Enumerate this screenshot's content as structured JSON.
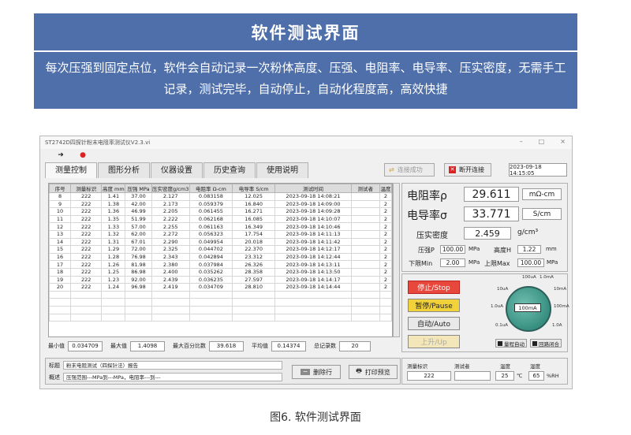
{
  "banner": {
    "title": "软件测试界面",
    "text": "每次压强到固定点位，软件会自动记录一次粉体高度、压强、电阻率、电导率、压实密度，无需手工记录，测试完毕，自动停止，自动化程度高，高效快捷"
  },
  "window": {
    "title": "ST2742D四探针粉末电阻率测试仪V2.3.vi",
    "tabs": [
      "测量控制",
      "图形分析",
      "仪器设置",
      "历史查询",
      "使用说明"
    ],
    "connect_success": "连接成功",
    "disconnect": "断开连接",
    "datetime": "2023-09-18 14:15:05"
  },
  "table": {
    "headers": [
      "序号",
      "测量标识",
      "高度 mm",
      "压强 MPa",
      "压实密度g/cm3",
      "电阻率 Ω-cm",
      "电导率 S/cm",
      "测试时间",
      "测试者",
      "温度"
    ],
    "rows": [
      [
        "8",
        "222",
        "1.41",
        "37.00",
        "2.127",
        "0.083158",
        "12.025",
        "2023-09-18 14:08:21",
        "",
        "2"
      ],
      [
        "9",
        "222",
        "1.38",
        "42.00",
        "2.173",
        "0.059379",
        "16.840",
        "2023-09-18 14:09:00",
        "",
        "2"
      ],
      [
        "10",
        "222",
        "1.36",
        "46.99",
        "2.205",
        "0.061455",
        "16.271",
        "2023-09-18 14:09:28",
        "",
        "2"
      ],
      [
        "11",
        "222",
        "1.35",
        "51.99",
        "2.222",
        "0.062168",
        "16.085",
        "2023-09-18 14:10:07",
        "",
        "2"
      ],
      [
        "12",
        "222",
        "1.33",
        "57.00",
        "2.255",
        "0.061163",
        "16.349",
        "2023-09-18 14:10:46",
        "",
        "2"
      ],
      [
        "13",
        "222",
        "1.32",
        "62.00",
        "2.272",
        "0.056323",
        "17.754",
        "2023-09-18 14:11:13",
        "",
        "2"
      ],
      [
        "14",
        "222",
        "1.31",
        "67.01",
        "2.290",
        "0.049954",
        "20.018",
        "2023-09-18 14:11:42",
        "",
        "2"
      ],
      [
        "15",
        "222",
        "1.29",
        "72.00",
        "2.325",
        "0.044702",
        "22.370",
        "2023-09-18 14:12:17",
        "",
        "2"
      ],
      [
        "16",
        "222",
        "1.28",
        "76.98",
        "2.343",
        "0.042894",
        "23.312",
        "2023-09-18 14:12:44",
        "",
        "2"
      ],
      [
        "17",
        "222",
        "1.26",
        "81.98",
        "2.380",
        "0.037984",
        "26.326",
        "2023-09-18 14:13:11",
        "",
        "2"
      ],
      [
        "18",
        "222",
        "1.25",
        "86.98",
        "2.400",
        "0.035262",
        "28.358",
        "2023-09-18 14:13:50",
        "",
        "2"
      ],
      [
        "19",
        "222",
        "1.23",
        "92.00",
        "2.439",
        "0.036235",
        "27.597",
        "2023-09-18 14:14:17",
        "",
        "2"
      ],
      [
        "20",
        "222",
        "1.24",
        "96.98",
        "2.419",
        "0.034709",
        "28.810",
        "2023-09-18 14:14:44",
        "",
        "2"
      ]
    ]
  },
  "stats": {
    "min_label": "最小值",
    "min": "0.034709",
    "max_label": "最大值",
    "max": "1.4098",
    "pct_label": "最大百分比数",
    "pct": "39.618",
    "avg_label": "平均值",
    "avg": "0.14374",
    "total_label": "总记录数",
    "total": "20"
  },
  "bottom": {
    "label1": "标题",
    "value1": "粉末电阻测试（四探针法）报告",
    "label2": "概述",
    "value2": "压强范围---MPa到---MPa，电阻率---到---",
    "delete": "删除行",
    "print": "打印预览"
  },
  "readings": {
    "resistivity_label": "电阻率ρ",
    "resistivity": "29.611",
    "resistivity_unit": "mΩ-cm",
    "conductivity_label": "电导率σ",
    "conductivity": "33.771",
    "conductivity_unit": "S/cm",
    "density_label": "压实密度",
    "density": "2.459",
    "density_unit": "g/cm³",
    "pressure_label": "压强P",
    "pressure": "100.00",
    "pressure_unit": "MPa",
    "height_label": "高度H",
    "height": "1.22",
    "height_unit": "mm",
    "lower_label": "下限Min",
    "lower": "2.00",
    "lower_unit": "MPa",
    "upper_label": "上限Max",
    "upper": "100.00",
    "upper_unit": "MPa"
  },
  "controls": {
    "stop": "停止/Stop",
    "pause": "暂停/Pause",
    "auto": "自动/Auto",
    "up": "上升/Up",
    "range_auto": "量程自动",
    "loop": "回路闭合",
    "dial_value": "100mA",
    "dial_labels": [
      "100uA",
      "1.0mA",
      "10uA",
      "10mA",
      "1.0uA",
      "100mA",
      "0.1uA",
      "1.0A"
    ]
  },
  "info": {
    "id_label": "测量标识",
    "id": "222",
    "tester_label": "测试者",
    "tester": "",
    "temp_label": "温度",
    "temp": "25",
    "temp_unit": "℃",
    "humidity_label": "湿度",
    "humidity": "65",
    "humidity_unit": "%RH"
  },
  "caption": "图6. 软件测试界面"
}
